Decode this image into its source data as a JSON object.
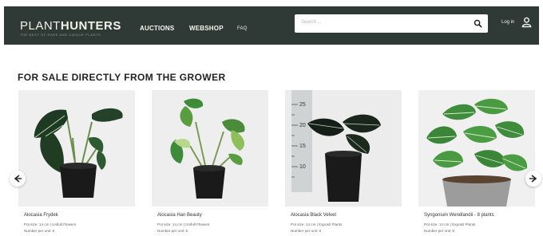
{
  "header": {
    "logo_plant": "PLANT",
    "logo_hunters": "HUNTERS",
    "tagline": "THE BEST OF RARE AND UNIQUE PLANTS",
    "nav": [
      "AUCTIONS",
      "WEBSHOP",
      "FAQ"
    ],
    "search_placeholder": "Search ...",
    "login_label": "Log in"
  },
  "section_title": "FOR SALE DIRECTLY FROM THE GROWER",
  "products": [
    {
      "name": "Alocasia Frydek",
      "meta1": "Pot size: 14 cm | Unifull Flowers",
      "meta2": "Number per unit: 8"
    },
    {
      "name": "Alocasia Han Beauty",
      "meta1": "Pot size: 14 cm | Unifull Flowers",
      "meta2": "Number per unit: 8"
    },
    {
      "name": "Alocasia Black Velvet",
      "meta1": "Pot size: 14 cm | Exposti Plants",
      "meta2": "Number per unit: 8"
    },
    {
      "name": "Syngonium Wendlandii - 8 plants",
      "meta1": "Pot size: 14 cm | Exposti Plants",
      "meta2": "Number per unit: 8"
    }
  ],
  "ruler_ticks": [
    "25",
    "20",
    "15",
    "10"
  ],
  "colors": {
    "header_bg": "#2f3a36",
    "leaf_dark": "#1f3a22",
    "leaf_light": "#3e8b3a",
    "pot": "#1a1a1a"
  },
  "icons": {
    "search": "search-icon",
    "user": "user-icon",
    "prev": "chevron-left-icon",
    "next": "chevron-right-icon"
  }
}
